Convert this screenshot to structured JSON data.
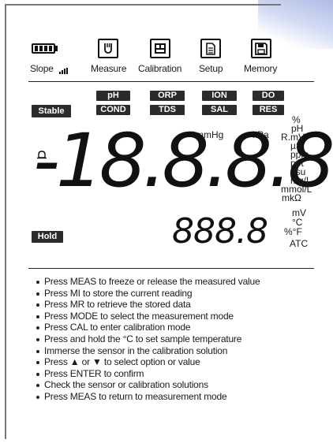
{
  "top_bar": {
    "items": [
      {
        "label": "Slope",
        "icon": "battery-icon"
      },
      {
        "label": "Measure",
        "icon": "probe-icon"
      },
      {
        "label": "Calibration",
        "icon": "calibration-icon"
      },
      {
        "label": "Setup",
        "icon": "document-icon"
      },
      {
        "label": "Memory",
        "icon": "save-icon"
      }
    ],
    "battery_level": 1.0,
    "slope_level": 1.0
  },
  "mode_tags": {
    "row1": [
      "pH",
      "ORP",
      "ION",
      "DO"
    ],
    "row2": [
      "COND",
      "TDS",
      "SAL",
      "RES"
    ]
  },
  "stable_label": "Stable",
  "hold_label": "Hold",
  "alarm_icon": "bell-icon",
  "units_top": {
    "mmhg": "mmHg",
    "kpa": "kPa"
  },
  "units_right": [
    "%",
    "pH",
    "R.mV",
    "µS",
    "ppm",
    "ppt",
    "psu",
    "mg/L",
    "mmol/L",
    "mkΩ"
  ],
  "units_second": [
    "mV",
    "°C",
    "%°F",
    "ATC"
  ],
  "main_display": "-18.8.8.8",
  "second_display": "888.8",
  "instructions": [
    "Press MEAS to freeze or release the measured value",
    "Press MI to store the current reading",
    "Press MR to retrieve the stored data",
    "Press MODE to select the measurement mode",
    "Press CAL to enter calibration mode",
    "Press and hold the °C to set sample temperature",
    "Immerse the sensor in the calibration solution",
    "Press ▲ or ▼ to select option or value",
    "Press ENTER to confirm",
    "Check the sensor or calibration solutions",
    "Press MEAS to return to measurement mode"
  ]
}
